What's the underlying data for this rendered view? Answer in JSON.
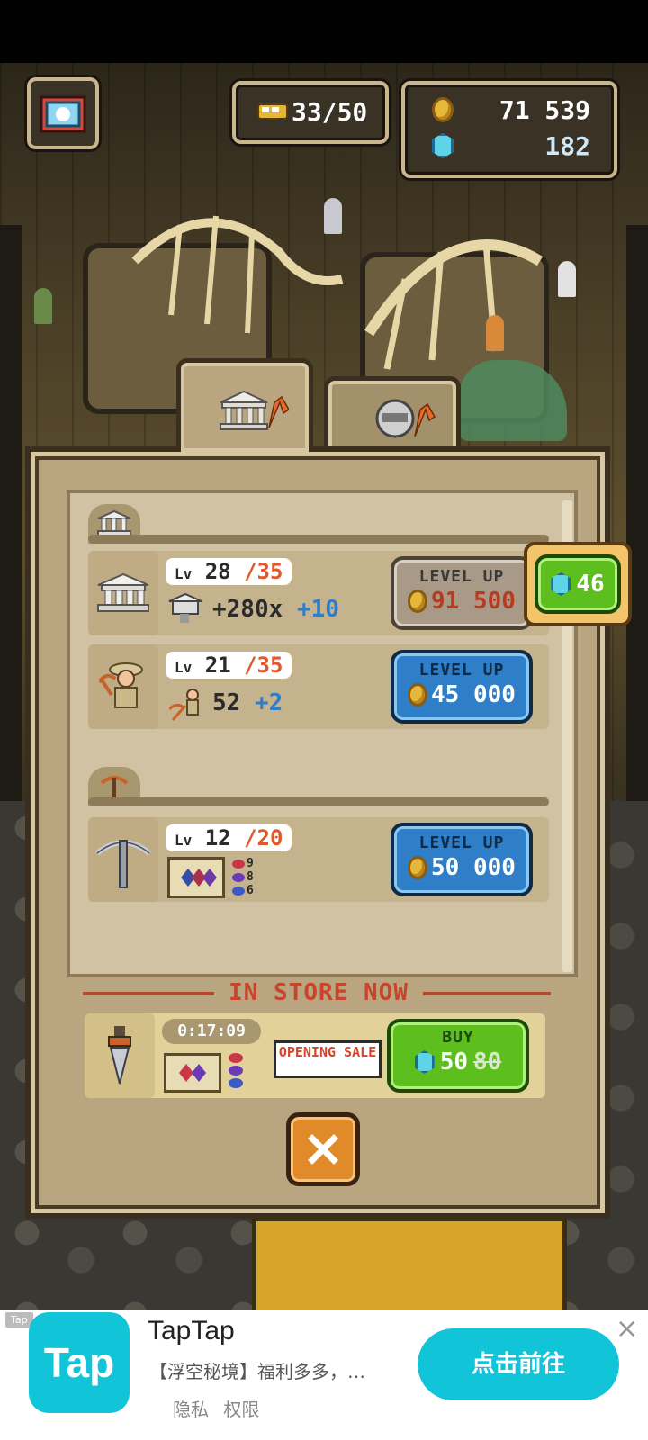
{
  "hud": {
    "visitors": "33/50",
    "coins": "71 539",
    "gems": "182"
  },
  "panel": {
    "rows": [
      {
        "level": "28",
        "max": "/35",
        "stat_main": "+280x",
        "stat_bonus": "+10",
        "button_label": "LEVEL UP",
        "price": "91 500",
        "gem_price": "46"
      },
      {
        "level": "21",
        "max": "/35",
        "stat_main": "52",
        "stat_bonus": "+2",
        "button_label": "LEVEL UP",
        "price": "45 000"
      },
      {
        "level": "12",
        "max": "/20",
        "chances": [
          "9",
          "8",
          "6"
        ],
        "button_label": "LEVEL UP",
        "price": "50 000"
      }
    ],
    "lv_prefix": "Lv",
    "store": {
      "title": "IN STORE NOW",
      "timer": "0:17:09",
      "sale_tag": "OPENING SALE",
      "buy_label": "BUY",
      "price": "50",
      "old_price": "80"
    }
  },
  "ad": {
    "badge": "Tap",
    "logo_text": "Tap",
    "title": "TapTap",
    "description": "【浮空秘境】福利多多，…",
    "links": [
      "隐私",
      "权限"
    ],
    "cta": "点击前往",
    "close": "×"
  }
}
